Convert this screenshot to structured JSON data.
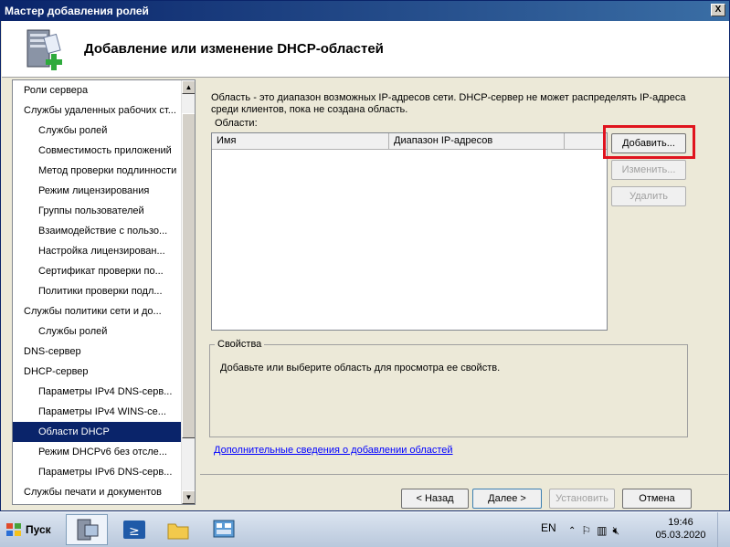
{
  "window": {
    "title": "Мастер добавления ролей",
    "close_label": "X",
    "heading": "Добавление или изменение DHCP-областей"
  },
  "nav": {
    "items": [
      {
        "label": "Роли сервера",
        "sub": false
      },
      {
        "label": "Службы удаленных рабочих ст...",
        "sub": false
      },
      {
        "label": "Службы ролей",
        "sub": true
      },
      {
        "label": "Совместимость приложений",
        "sub": true
      },
      {
        "label": "Метод проверки подлинности",
        "sub": true
      },
      {
        "label": "Режим лицензирования",
        "sub": true
      },
      {
        "label": "Группы пользователей",
        "sub": true
      },
      {
        "label": "Взаимодействие с пользо...",
        "sub": true
      },
      {
        "label": "Настройка лицензирован...",
        "sub": true
      },
      {
        "label": "Сертификат проверки по...",
        "sub": true
      },
      {
        "label": "Политики проверки подл...",
        "sub": true
      },
      {
        "label": "Службы политики сети и до...",
        "sub": false
      },
      {
        "label": "Службы ролей",
        "sub": true
      },
      {
        "label": "DNS-сервер",
        "sub": false
      },
      {
        "label": "DHCP-сервер",
        "sub": false
      },
      {
        "label": "Параметры IPv4 DNS-серв...",
        "sub": true
      },
      {
        "label": "Параметры IPv4 WINS-се...",
        "sub": true
      },
      {
        "label": "Области DHCP",
        "sub": true,
        "selected": true
      },
      {
        "label": "Режим DHCPv6 без отсле...",
        "sub": true
      },
      {
        "label": "Параметры IPv6 DNS-серв...",
        "sub": true
      },
      {
        "label": "Службы печати и документов",
        "sub": false
      }
    ]
  },
  "main": {
    "description": "Область - это диапазон возможных IP-адресов сети. DHCP-сервер не может распределять IP-адреса среди клиентов, пока не создана область.",
    "areas_label": "Области:",
    "columns": [
      "Имя",
      "Диапазон IP-адресов",
      ""
    ],
    "add_button": "Добавить...",
    "edit_button": "Изменить...",
    "delete_button": "Удалить",
    "properties_legend": "Свойства",
    "properties_text": "Добавьте или выберите область для просмотра ее свойств.",
    "info_link": "Дополнительные сведения о добавлении областей"
  },
  "footer": {
    "back": "< Назад",
    "next": "Далее >",
    "install": "Установить",
    "cancel": "Отмена"
  },
  "taskbar": {
    "start": "Пуск",
    "lang": "EN",
    "time": "19:46",
    "date": "05.03.2020"
  },
  "colors": {
    "selection": "#0a246a",
    "highlight": "#e0141e",
    "link": "#0000ff"
  }
}
